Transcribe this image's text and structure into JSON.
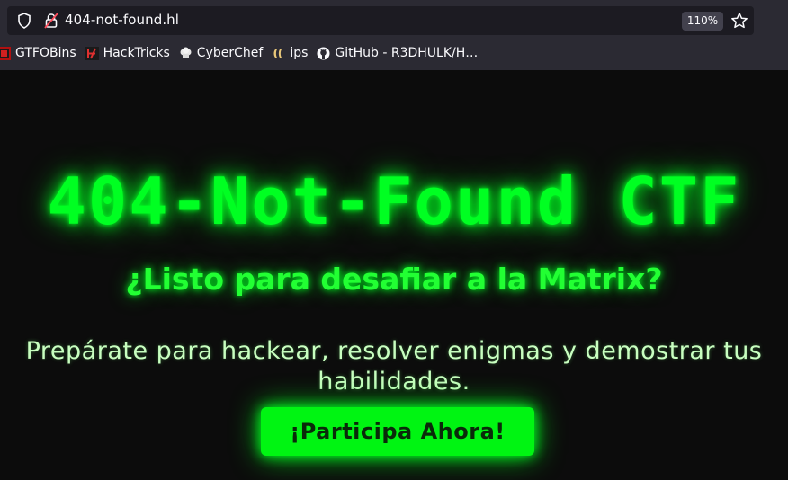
{
  "browser": {
    "url": "404-not-found.hl",
    "zoom": "110%",
    "bookmarks": [
      {
        "label": "GTFOBins",
        "icon": "gtfobins-icon"
      },
      {
        "label": "HackTricks",
        "icon": "hacktricks-icon"
      },
      {
        "label": "CyberChef",
        "icon": "cyberchef-icon"
      },
      {
        "label": "ips",
        "icon": "ips-icon"
      },
      {
        "label": "GitHub - R3DHULK/H…",
        "icon": "github-icon"
      }
    ]
  },
  "page": {
    "title": "404-Not-Found CTF",
    "subtitle": "¿Listo para desafiar a la Matrix?",
    "description": "Prepárate para hackear, resolver enigmas y demostrar tus habilidades.",
    "cta_label": "¡Participa Ahora!"
  },
  "colors": {
    "accent": "#00ff22",
    "background": "#0c0c0c",
    "chrome": "#2b2a33"
  }
}
